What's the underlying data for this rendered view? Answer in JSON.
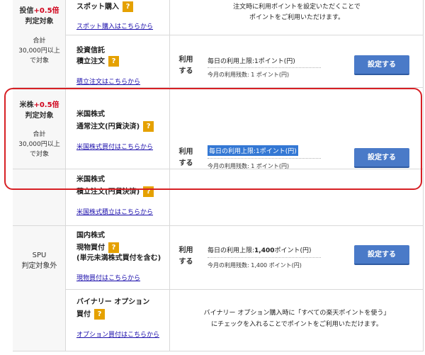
{
  "rows": [
    {
      "category": {
        "prefix": "投信",
        "bonus": "+0.5倍",
        "line2": "判定対象",
        "sub1": "合計",
        "sub2": "30,000円以上",
        "sub3": "で対象"
      },
      "spot": {
        "title": "スポット購入",
        "link": "スポット購入はこちらから",
        "message1": "注文時に利用ポイントを設定いただくことで",
        "message2": "ポイントをご利用いただけます。"
      },
      "reserve": {
        "title1": "投資信託",
        "title2": "積立注文",
        "link": "積立注文はこちらから",
        "use1": "利用",
        "use2": "する",
        "limit": "毎日の利用上限:1ポイント(円)",
        "month": "今月の利用残数: 1 ポイント(円)",
        "button": "設定する"
      }
    },
    {
      "category": {
        "prefix": "米株",
        "bonus": "+0.5倍",
        "line2": "判定対象",
        "sub1": "合計",
        "sub2": "30,000円以上",
        "sub3": "で対象"
      },
      "us_normal": {
        "title1": "米国株式",
        "title2": "通常注文(円貨決済)",
        "link": "米国株式買付はこちらから",
        "use1": "利用",
        "use2": "する",
        "limit": "毎日の利用上限:1ポイント(円)",
        "month": "今月の利用残数: 1 ポイント(円)",
        "button": "設定する"
      },
      "us_reserve": {
        "title1": "米国株式",
        "title2": "積立注文(円貨決済)",
        "link": "米国株式積立はこちらから"
      }
    },
    {
      "category": {
        "line1": "SPU",
        "line2": "判定対象外"
      },
      "domestic": {
        "title1": "国内株式",
        "title2": "現物買付",
        "title3": "(単元未満株式買付を含む)",
        "link": "現物買付はこちらから",
        "use1": "利用",
        "use2": "する",
        "limit_prefix": "毎日の利用上限:",
        "limit_value": "1,400",
        "limit_suffix": "ポイント(円)",
        "month": "今月の利用残数: 1,400 ポイント(円)",
        "button": "設定する"
      },
      "binary": {
        "title1": "バイナリー オプション",
        "title2": "買付",
        "link": "オプション買付はこちらから",
        "message1": "バイナリー オプション購入時に「すべての楽天ポイントを使う」",
        "message2": "にチェックを入れることでポイントをご利用いただけます。"
      }
    }
  ],
  "badge": "?",
  "colors": {
    "accent": "#4a7ac8",
    "badge": "#e5a100",
    "highlight": "#3478d4",
    "frame": "#d72025",
    "bonus": "#d0021b"
  }
}
